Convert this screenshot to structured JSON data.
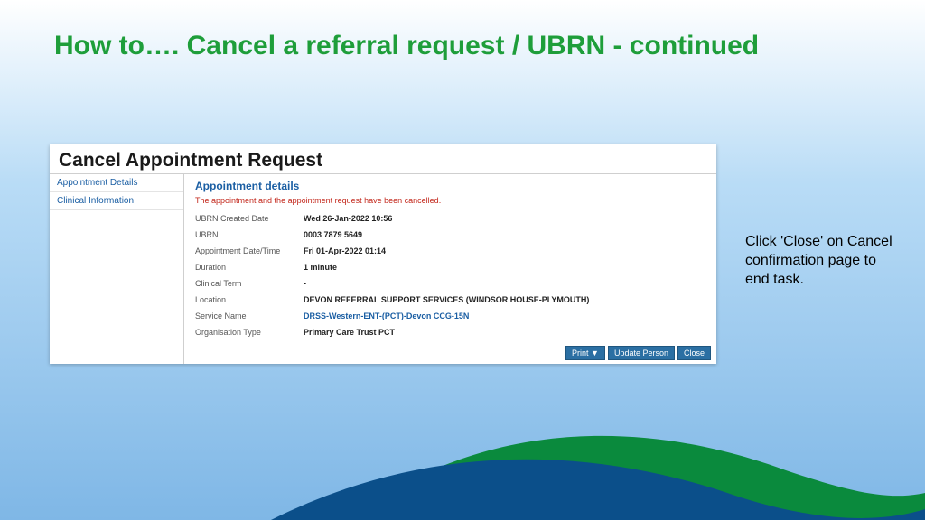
{
  "slide": {
    "title": "How to…. Cancel a referral request / UBRN - continued",
    "annotation": "Click 'Close' on Cancel confirmation page to end task."
  },
  "app": {
    "header": "Cancel Appointment Request",
    "sidebar": {
      "items": [
        {
          "label": "Appointment Details"
        },
        {
          "label": "Clinical Information"
        }
      ]
    },
    "content": {
      "section_title": "Appointment details",
      "cancel_message": "The appointment and the appointment request have been cancelled.",
      "rows": [
        {
          "label": "UBRN Created Date",
          "value": "Wed 26-Jan-2022 10:56",
          "link": false
        },
        {
          "label": "UBRN",
          "value": "0003 7879 5649",
          "link": false
        },
        {
          "label": "Appointment Date/Time",
          "value": "Fri 01-Apr-2022 01:14",
          "link": false
        },
        {
          "label": "Duration",
          "value": "1 minute",
          "link": false
        },
        {
          "label": "Clinical Term",
          "value": "-",
          "link": false
        },
        {
          "label": "Location",
          "value": "DEVON REFERRAL SUPPORT SERVICES (WINDSOR HOUSE-PLYMOUTH)",
          "link": false
        },
        {
          "label": "Service Name",
          "value": "DRSS-Western-ENT-(PCT)-Devon CCG-15N",
          "link": true
        },
        {
          "label": "Organisation Type",
          "value": "Primary Care Trust PCT",
          "link": false
        }
      ]
    },
    "actions": {
      "print": "Print ▼",
      "update": "Update Person",
      "close": "Close"
    }
  }
}
